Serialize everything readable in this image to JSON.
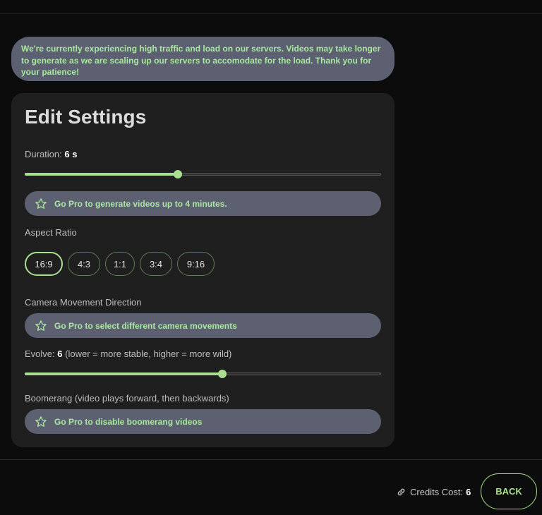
{
  "notice": "We're currently experiencing high traffic and load on our servers. Videos may take longer to generate as we are scaling up our servers to accomodate for the load. Thank you for your patience!",
  "settings": {
    "title": "Edit Settings",
    "duration": {
      "label": "Duration:",
      "value": "6 s",
      "slider_fraction": 0.43
    },
    "pro_duration": "Go Pro to generate videos up to 4 minutes.",
    "aspect_label": "Aspect Ratio",
    "aspect_options": [
      "16:9",
      "4:3",
      "1:1",
      "3:4",
      "9:16"
    ],
    "aspect_selected": "16:9",
    "camera_label": "Camera Movement Direction",
    "pro_camera": "Go Pro to select different camera movements",
    "evolve": {
      "label": "Evolve:",
      "value": "6",
      "hint": "(lower = more stable, higher = more wild)",
      "slider_fraction": 0.555
    },
    "boomerang_label": "Boomerang (video plays forward, then backwards)",
    "pro_boomerang": "Go Pro to disable boomerang videos"
  },
  "footer": {
    "credits_label": "Credits Cost:",
    "credits_value": "6",
    "back_label": "BACK"
  },
  "colors": {
    "accent": "#a8e08f",
    "pill": "#5d6070",
    "card": "#1f1f1f",
    "background": "#0c0c0c"
  },
  "icons": {
    "pro": "star-icon",
    "credits": "link-icon"
  }
}
